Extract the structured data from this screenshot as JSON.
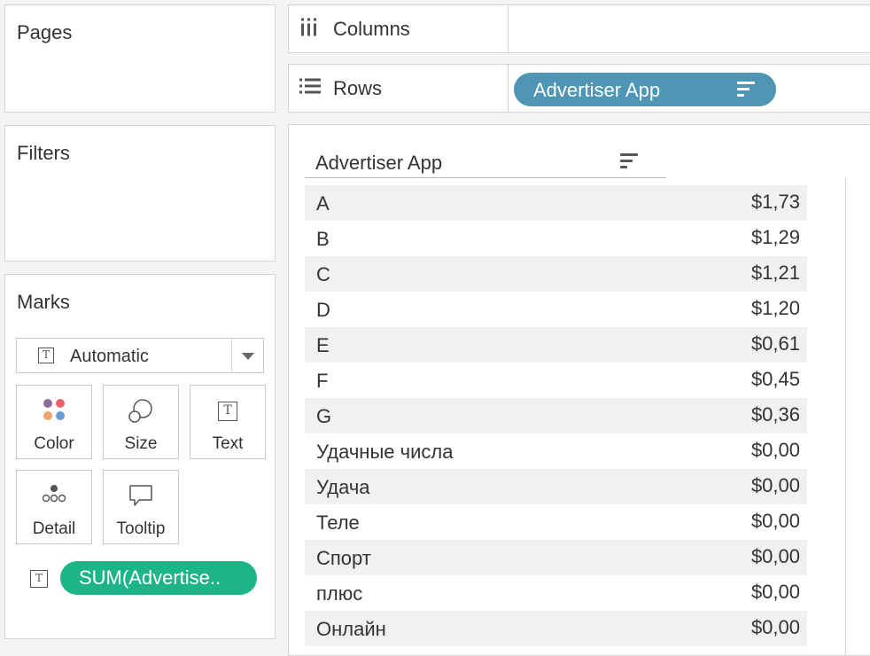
{
  "pages": {
    "title": "Pages"
  },
  "filters": {
    "title": "Filters"
  },
  "marks": {
    "title": "Marks",
    "mark_type": "Automatic",
    "buttons": {
      "color": "Color",
      "size": "Size",
      "text": "Text",
      "detail": "Detail",
      "tooltip": "Tooltip"
    },
    "text_pill": "SUM(Advertise.."
  },
  "shelves": {
    "columns_label": "Columns",
    "rows_label": "Rows",
    "rows_pill": "Advertiser App"
  },
  "table": {
    "header": "Advertiser App",
    "rows": [
      {
        "name": "A",
        "value": "$1,73"
      },
      {
        "name": "B",
        "value": "$1,29"
      },
      {
        "name": "C",
        "value": "$1,21"
      },
      {
        "name": "D",
        "value": "$1,20"
      },
      {
        "name": "E",
        "value": "$0,61"
      },
      {
        "name": "F",
        "value": "$0,45"
      },
      {
        "name": "G",
        "value": "$0,36"
      },
      {
        "name": "Удачные числа",
        "value": "$0,00"
      },
      {
        "name": "Удача",
        "value": "$0,00"
      },
      {
        "name": "Теле",
        "value": "$0,00"
      },
      {
        "name": "Спорт",
        "value": "$0,00"
      },
      {
        "name": "плюс",
        "value": "$0,00"
      },
      {
        "name": "Онлайн",
        "value": "$0,00"
      }
    ]
  },
  "colors": {
    "rows_pill": "#4e96b3",
    "measure_pill": "#1db586",
    "color_dots": [
      "#8e6c9a",
      "#e8636a",
      "#f0a36b",
      "#6d9bd1"
    ]
  }
}
